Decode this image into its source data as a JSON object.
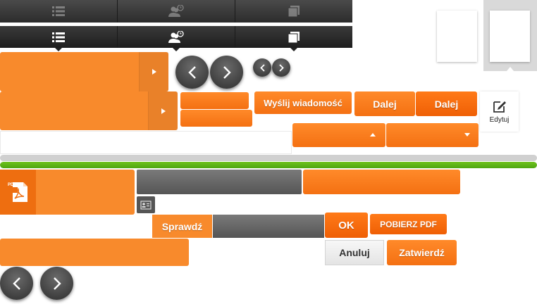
{
  "colors": {
    "accent": "#f47012",
    "dark_bar": "#2c2c2c",
    "progress_green": "#5fb618"
  },
  "tabs": [
    {
      "icon": "list-icon"
    },
    {
      "icon": "user-clock-icon"
    },
    {
      "icon": "document-edit-icon"
    }
  ],
  "buttons": {
    "send_message": "Wyślij wiadomość",
    "next_1": "Dalej",
    "next_2": "Dalej",
    "edit": "Edytuj",
    "check": "Sprawdź",
    "ok": "OK",
    "download_pdf": "POBIERZ PDF",
    "cancel": "Anuluj",
    "confirm": "Zatwierdź"
  },
  "progress": {
    "value": 100
  },
  "file_badge": "PDF"
}
